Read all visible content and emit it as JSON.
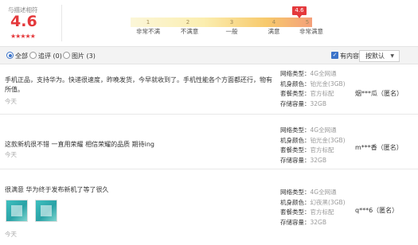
{
  "rating": {
    "match_label": "与描述相符",
    "score": "4.6",
    "stars": "★★★★★",
    "pin": "4.6",
    "ticks": [
      "1",
      "2",
      "3",
      "4",
      "5"
    ],
    "levels": [
      "非常不满",
      "不满意",
      "一般",
      "满意",
      "非常满意"
    ]
  },
  "filters": {
    "all": "全部",
    "followup": "追评 (0)",
    "pictures": "图片 (3)",
    "has_content": "有内容",
    "sort": "按默认",
    "sort_caret": "▼"
  },
  "attr_labels": {
    "network": "网络类型：",
    "color": "机身颜色：",
    "package": "套餐类型：",
    "storage": "存储容量："
  },
  "reviews": [
    {
      "text": "手机正品，支持华为。快递很速度，昨晚发货，今早就收到了。手机性能各个方面都还行，物有所值。",
      "date": "今天",
      "network": "4G全网通",
      "color": "铂光金(3GB)",
      "package": "官方标配",
      "storage": "32GB",
      "user": "烟***瓜（匿名）"
    },
    {
      "text": "这款新机很不错 一直用荣耀 相信荣耀的品质 期待ing",
      "date": "今天",
      "network": "4G全网通",
      "color": "铂光金(3GB)",
      "package": "官方标配",
      "storage": "32GB",
      "user": "m***香（匿名）"
    },
    {
      "text": "很满意 华为终于发布新机了等了很久",
      "date": "今天",
      "network": "4G全网通",
      "color": "幻夜黑(3GB)",
      "package": "官方标配",
      "storage": "32GB",
      "user": "q***6（匿名）"
    }
  ]
}
